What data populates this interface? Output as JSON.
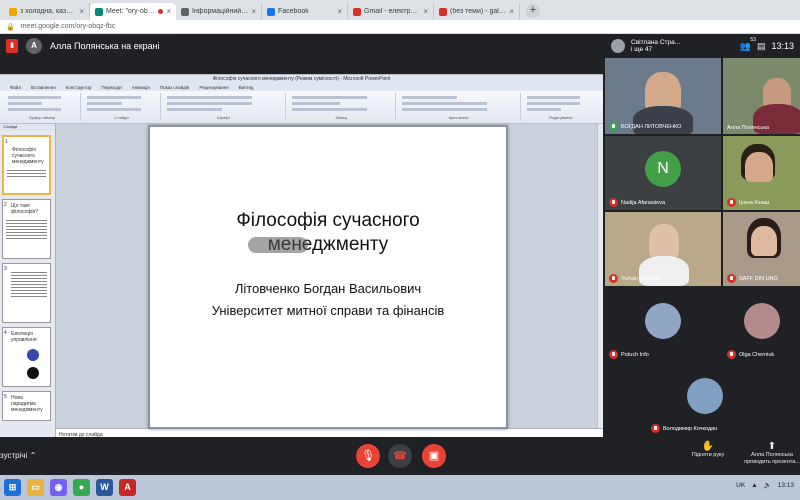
{
  "browser": {
    "tabs": [
      {
        "title": "з холодна, казнаненч",
        "active": false,
        "icon_color": "#f2a600"
      },
      {
        "title": "Meet: \"ory-obqz-fbc\"",
        "active": true,
        "icon_color": "#00897b",
        "recording": true
      },
      {
        "title": "Інформаційний_вопт.pdf",
        "active": false,
        "icon_color": "#5f6368"
      },
      {
        "title": "Facebook",
        "active": false,
        "icon_color": "#1877f2"
      },
      {
        "title": "Gmail - електронна пошта від",
        "active": false,
        "icon_color": "#d93025"
      },
      {
        "title": "(без теми) - galaprolov@gmail",
        "active": false,
        "icon_color": "#d93025"
      }
    ],
    "new_tab_label": "+",
    "url": "meet.google.com/ory-obqz-fbc"
  },
  "meet": {
    "presenter_label": "Алла Полянська на екрані",
    "presenter_initial": "A",
    "top_info": {
      "name": "Світлана Стра...",
      "subtitle": "і ще 47",
      "participant_count": "53",
      "time": "13:13"
    },
    "tiles": [
      {
        "name": "БОГДАН ЛИТОВЧЕНКО",
        "initial": "",
        "bg": "#6b7b8c"
      },
      {
        "name": "Алла Полянська",
        "initial": "",
        "bg": "#7a8a6a"
      },
      {
        "name": "Nadija Afanasieva",
        "initial": "N",
        "bg": "#3c4043",
        "avatar_color": "#43a047"
      },
      {
        "name": "Ірина Кінаш",
        "initial": "",
        "bg": "#8a9a5a"
      },
      {
        "name": "Yurkan Sheydak",
        "initial": "",
        "bg": "#b9a98a"
      },
      {
        "name": "SAFF DIN UNO",
        "initial": "",
        "bg": "#a99a8a"
      },
      {
        "name": "Potuch Info",
        "initial": "",
        "bg": "#202124"
      },
      {
        "name": "Olga Cherniuk",
        "initial": "",
        "bg": "#202124"
      },
      {
        "name": "Володимир Кочкодан",
        "initial": "",
        "bg": "#202124"
      }
    ],
    "bottom": {
      "meeting_label": "зустрічі",
      "raise_hand": "Підняти руку",
      "presenting": "Алла Полянська проводить презента..."
    }
  },
  "powerpoint": {
    "window_title": "Філософія сучасного менеджменту (Режим сумісності) - Microsoft PowerPoint",
    "ribbon_tabs": [
      "Файл",
      "Вставлення",
      "Конструктор",
      "Переходи",
      "Анімація",
      "Показ слайдів",
      "Рецензування",
      "Вигляд"
    ],
    "ribbon_groups": [
      "Буфер обміну",
      "Слайди",
      "Шрифт",
      "Абзац",
      "Креслення",
      "Редагування"
    ],
    "slides_panel_label": "Слайди",
    "thumbnails": [
      {
        "num": "1",
        "text": "Філософія сучасного менеджменту"
      },
      {
        "num": "2",
        "text": "Що таке філософія?"
      },
      {
        "num": "3",
        "text": ""
      },
      {
        "num": "4",
        "text": "Еволюція управління"
      },
      {
        "num": "5",
        "text": "Нова парадигма менеджменту"
      }
    ],
    "slide": {
      "title": "Філософія сучасного менеджменту",
      "author": "Літовченко Богдан Васильович",
      "university": "Університет митної справи та фінансів"
    },
    "notes_placeholder": "Нотатки до слайда"
  },
  "taskbar": {
    "tray_lang": "UK",
    "tray_time": "13:13"
  }
}
